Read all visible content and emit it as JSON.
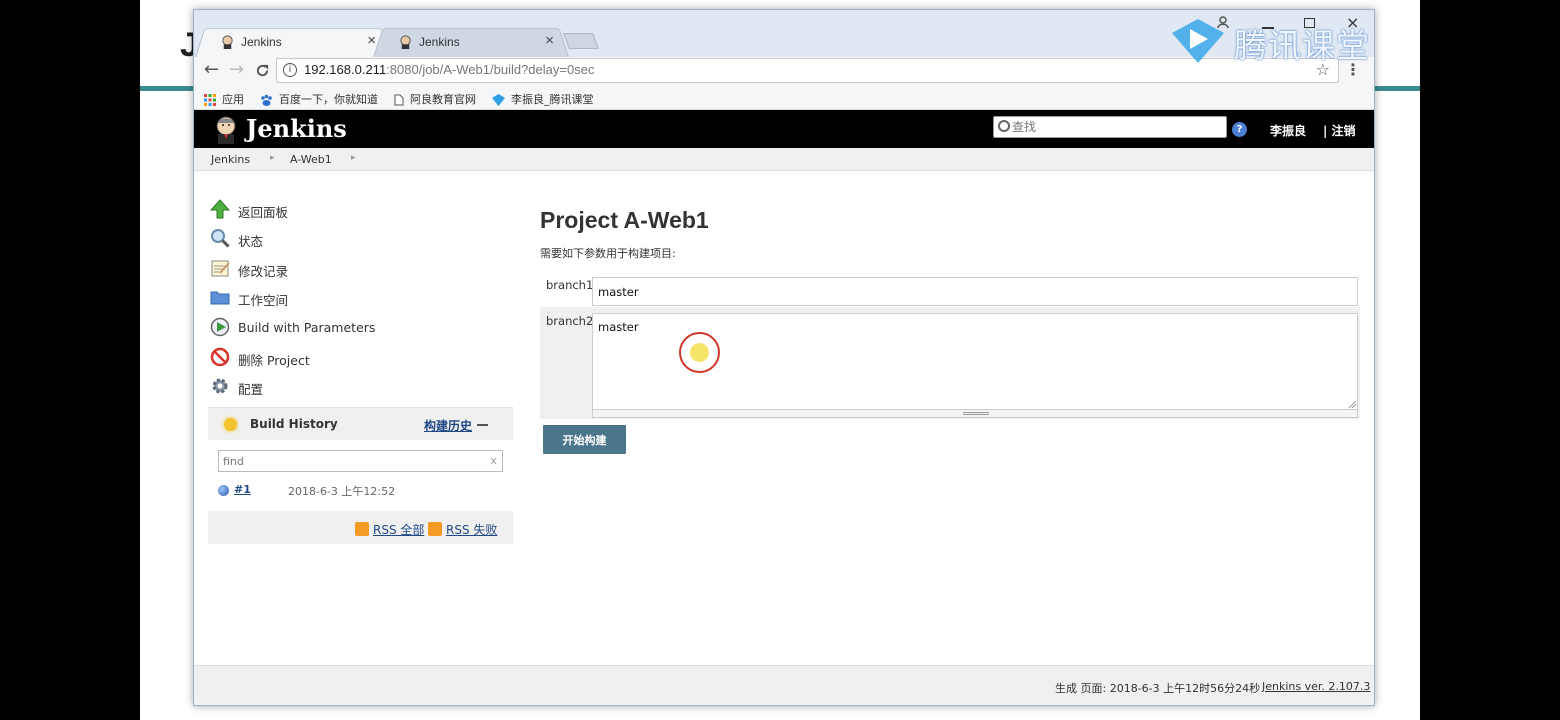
{
  "slide": {
    "initial": "J"
  },
  "browser": {
    "tabs": [
      {
        "title": "Jenkins",
        "close": "×"
      },
      {
        "title": "Jenkins",
        "close": "×"
      }
    ],
    "window_close": "×",
    "url_host": "192.168.0.211",
    "url_path": ":8080/job/A-Web1/build?delay=0sec",
    "bookmarks": [
      "应用",
      "百度一下，你就知道",
      "阿良教育官网",
      "李振良_腾讯课堂"
    ]
  },
  "jenkins": {
    "title": "Jenkins",
    "search_placeholder": "查找",
    "help": "?",
    "user": "李振良",
    "logout": "| 注销",
    "breadcrumb": [
      "Jenkins",
      "A-Web1"
    ],
    "tasks": [
      "返回面板",
      "状态",
      "修改记录",
      "工作空间",
      "Build with Parameters",
      "删除 Project",
      "配置"
    ],
    "build_history": {
      "title": "Build History",
      "trend": "构建历史",
      "find_placeholder": "find",
      "clear": "x",
      "builds": [
        {
          "number": "#1",
          "date": "2018-6-3 上午12:52"
        }
      ],
      "rss_all": "RSS 全部",
      "rss_failed": "RSS 失败"
    },
    "main": {
      "title": "Project A-Web1",
      "description": "需要如下参数用于构建项目:",
      "params": [
        {
          "name": "branch1",
          "value": "master"
        },
        {
          "name": "branch2",
          "value": "master"
        }
      ],
      "build_button": "开始构建"
    },
    "footer": {
      "generated": "生成 页面: 2018-6-3 上午12时56分24秒",
      "version": "Jenkins ver. 2.107.3"
    }
  },
  "watermark": {
    "text": "腾讯课堂"
  },
  "colors": {
    "header_bg": "#000000",
    "build_button": "#4b758b",
    "link": "#204a87",
    "slide_rule": "#3b8c8f"
  }
}
